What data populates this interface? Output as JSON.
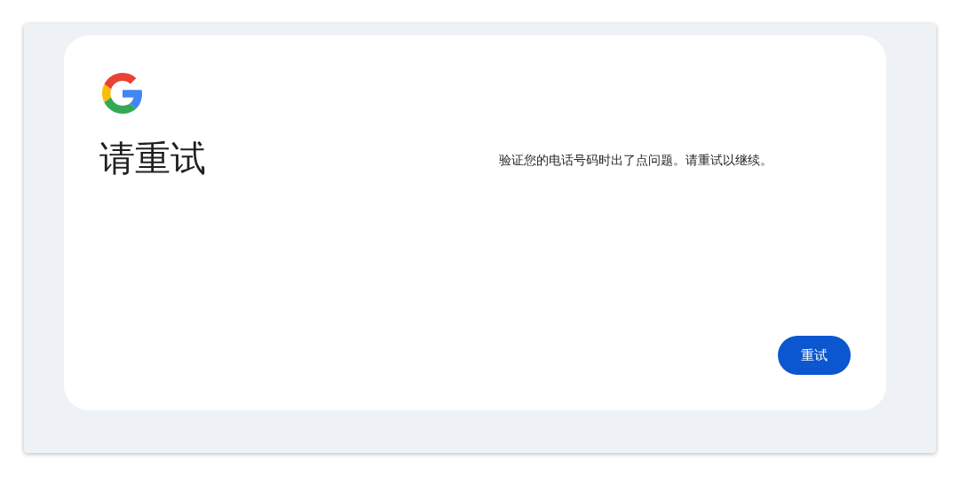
{
  "title": "请重试",
  "message": "验证您的电话号码时出了点问题。请重试以继续。",
  "buttons": [
    {
      "label": "重试",
      "kind": "primary"
    }
  ]
}
